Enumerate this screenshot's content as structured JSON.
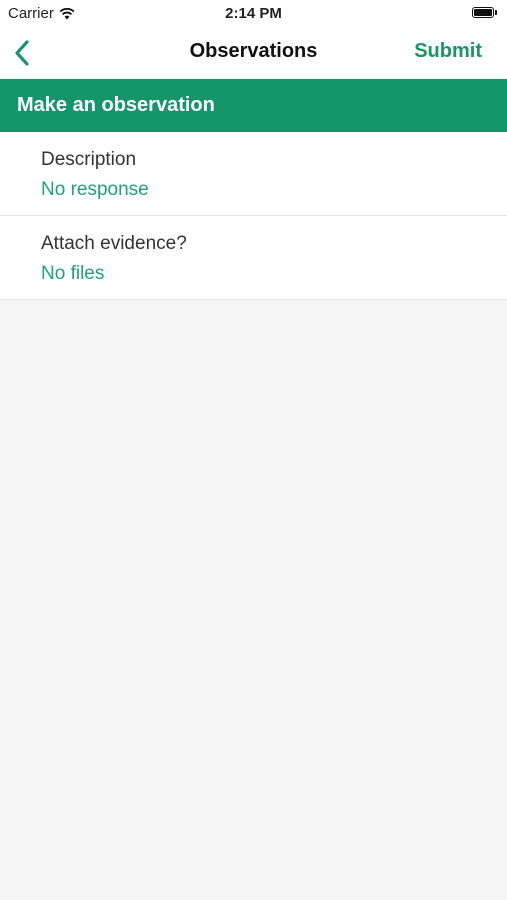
{
  "status_bar": {
    "carrier": "Carrier",
    "time": "2:14 PM",
    "battery_level": 1.0
  },
  "nav": {
    "back_icon": "chevron-left-icon",
    "title": "Observations",
    "submit_label": "Submit"
  },
  "section": {
    "title": "Make an observation"
  },
  "form": {
    "rows": [
      {
        "label": "Description",
        "value": "No response"
      },
      {
        "label": "Attach evidence?",
        "value": "No files"
      }
    ]
  },
  "colors": {
    "accent": "#14956a",
    "link": "#1fa275",
    "background": "#f5f5f5"
  }
}
